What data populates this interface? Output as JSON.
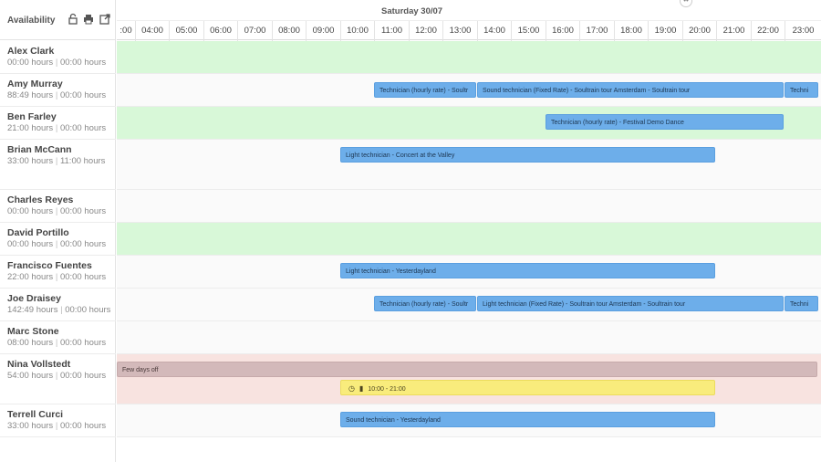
{
  "sidebar": {
    "title": "Availability",
    "icons": [
      "lock-icon",
      "print-icon",
      "external-link-icon"
    ]
  },
  "timeline": {
    "date": "Saturday 30/07",
    "hours": [
      ":00",
      "04:00",
      "05:00",
      "06:00",
      "07:00",
      "08:00",
      "09:00",
      "10:00",
      "11:00",
      "12:00",
      "13:00",
      "14:00",
      "15:00",
      "16:00",
      "17:00",
      "18:00",
      "19:00",
      "20:00",
      "21:00",
      "22:00",
      "23:00"
    ]
  },
  "people": [
    {
      "name": "Alex Clark",
      "hours": "00:00 hours",
      "hours2": "00:00 hours"
    },
    {
      "name": "Amy Murray",
      "hours": "88:49 hours",
      "hours2": "00:00 hours"
    },
    {
      "name": "Ben Farley",
      "hours": "21:00 hours",
      "hours2": "00:00 hours"
    },
    {
      "name": "Brian McCann",
      "hours": "33:00 hours",
      "hours2": "11:00 hours"
    },
    {
      "name": "Charles Reyes",
      "hours": "00:00 hours",
      "hours2": "00:00 hours"
    },
    {
      "name": "David Portillo",
      "hours": "00:00 hours",
      "hours2": "00:00 hours"
    },
    {
      "name": "Francisco Fuentes",
      "hours": "22:00 hours",
      "hours2": "00:00 hours"
    },
    {
      "name": "Joe Draisey",
      "hours": "142:49 hours",
      "hours2": "00:00 hours"
    },
    {
      "name": "Marc Stone",
      "hours": "08:00 hours",
      "hours2": "00:00 hours"
    },
    {
      "name": "Nina Vollstedt",
      "hours": "54:00 hours",
      "hours2": "00:00 hours"
    },
    {
      "name": "Terrell Curci",
      "hours": "33:00 hours",
      "hours2": "00:00 hours"
    }
  ],
  "events": {
    "amy_1": "Technician (hourly rate) - Soultr",
    "amy_2": "Sound technician (Fixed Rate) - Soultrain tour Amsterdam - Soultrain tour",
    "amy_3": "Techni",
    "ben_1": "Technician (hourly rate) - Festival Demo Dance",
    "brian_1": "Light technician - Concert at the Valley",
    "francisco_1": "Light technician - Yesterdayland",
    "joe_1": "Technician (hourly rate) - Soultr",
    "joe_2": "Light technician (Fixed Rate) - Soultrain tour Amsterdam - Soultrain tour",
    "joe_3": "Techni",
    "nina_off": "Few days off",
    "nina_avail": "10:00 - 21:00",
    "terrell_1": "Sound technician - Yesterdayland"
  },
  "colors": {
    "available": "#d8f8d8",
    "unavailable": "#f8e3e0",
    "event": "#6daeea",
    "time_off": "#d3b9ba",
    "availability_slot": "#f9ec7c"
  }
}
